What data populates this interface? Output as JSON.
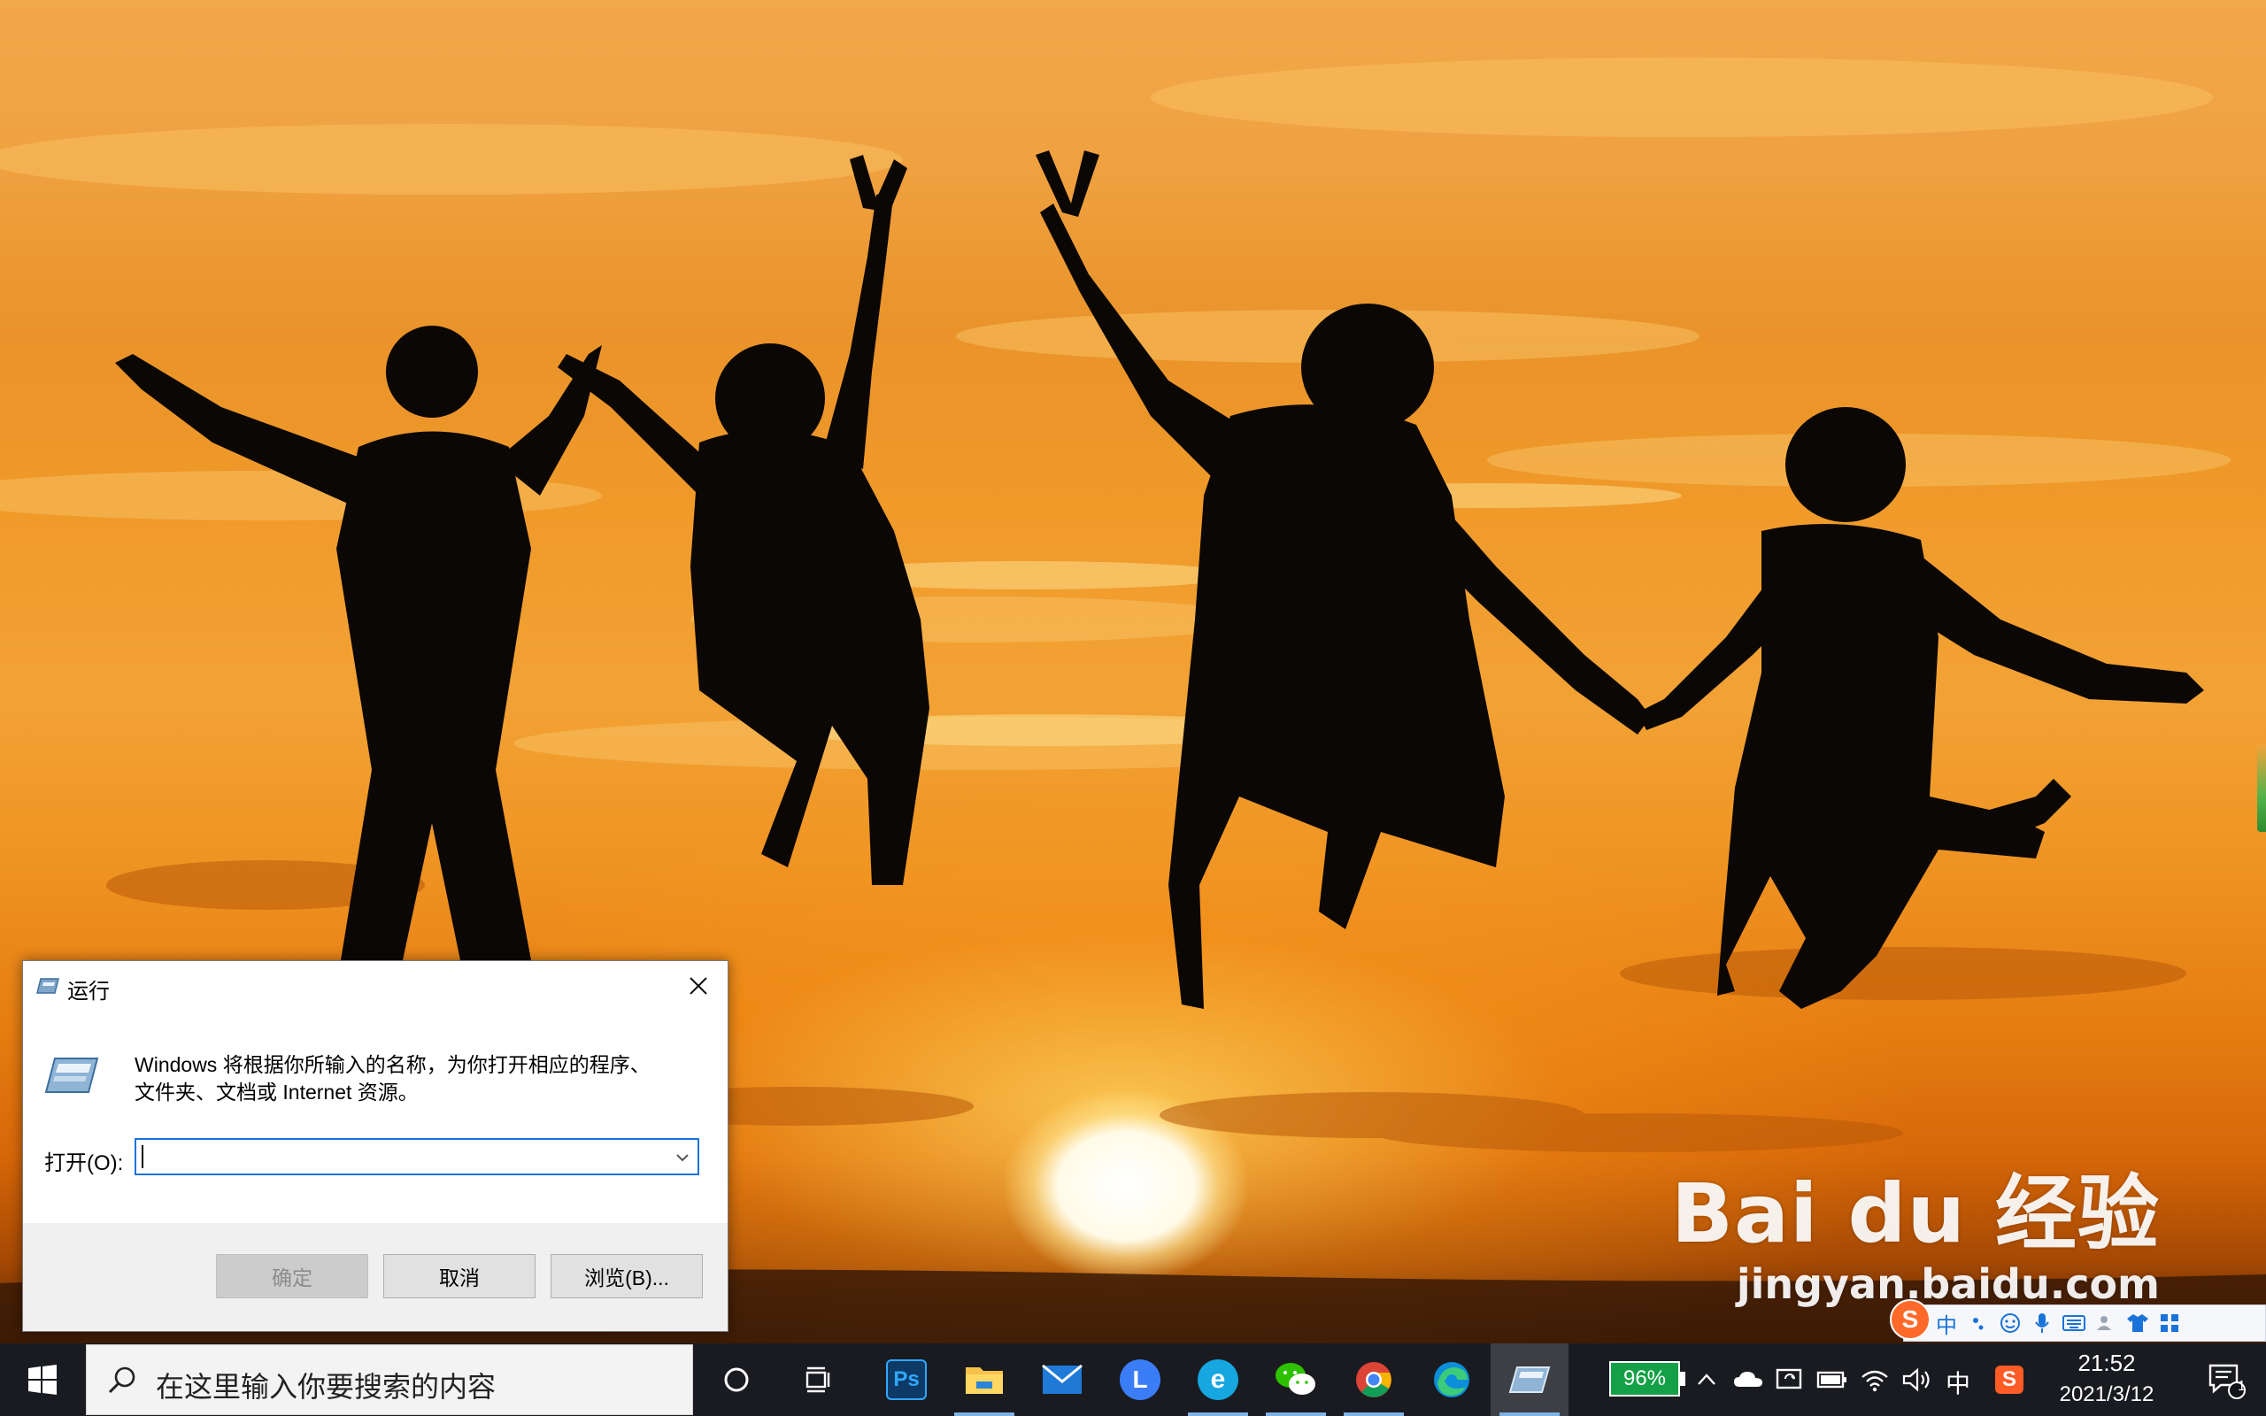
{
  "run_dialog": {
    "title": "运行",
    "description_line1": "Windows 将根据你所输入的名称，为你打开相应的程序、",
    "description_line2": "文件夹、文档或 Internet 资源。",
    "open_label": "打开(O):",
    "open_value": "",
    "buttons": {
      "ok": "确定",
      "cancel": "取消",
      "browse": "浏览(B)..."
    }
  },
  "taskbar": {
    "search_placeholder": "在这里输入你要搜索的内容",
    "pinned_apps": [
      "cortana-icon",
      "task-view-icon",
      "photoshop-icon",
      "file-explorer-icon",
      "mail-icon",
      "lark-icon",
      "ie-icon",
      "wechat-icon",
      "chrome-icon",
      "edge-icon",
      "run-icon"
    ],
    "battery_badge": "96%",
    "ime_mode": "中",
    "time": "21:52",
    "date": "2021/3/12",
    "notification_count": "1"
  },
  "ime_toolbar": {
    "logo": "S",
    "mode": "中"
  },
  "watermark": {
    "brand": "Bai du 经验",
    "url": "jingyan.baidu.com"
  },
  "colors": {
    "accent": "#1a73d9",
    "battery_green": "#14a046",
    "taskbar_bg": "#12141a",
    "dialog_footer": "#f0f0f0"
  }
}
